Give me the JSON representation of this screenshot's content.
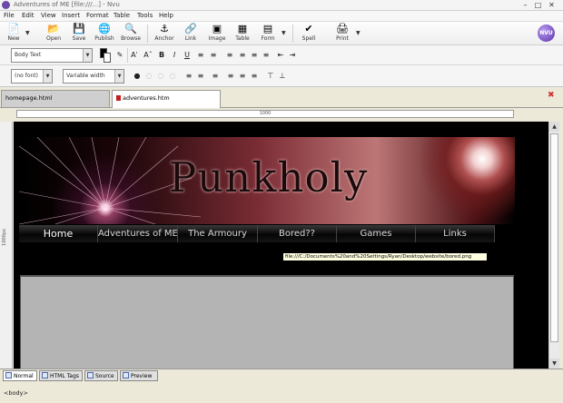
{
  "window": {
    "title": "Adventures of ME [file:///...] - Nvu"
  },
  "menu": [
    "File",
    "Edit",
    "View",
    "Insert",
    "Format",
    "Table",
    "Tools",
    "Help"
  ],
  "toolbar": {
    "new": "New",
    "open": "Open",
    "save": "Save",
    "publish": "Publish",
    "browse": "Browse",
    "anchor": "Anchor",
    "link": "Link",
    "image": "Image",
    "table": "Table",
    "form": "Form",
    "spell": "Spell",
    "print": "Print",
    "logo": "NVU"
  },
  "format": {
    "paragraph_format": "Body Text",
    "font": "(no font)",
    "width": "Variable width"
  },
  "tabs": {
    "inactive": "homepage.html",
    "active": "adventures.htm"
  },
  "ruler_label": "1000",
  "side_ruler_label": "1000px",
  "page": {
    "logo_text": "Punkholy",
    "nav": [
      "Home",
      "Adventures of ME",
      "The Armoury",
      "Bored??",
      "Games",
      "Links"
    ],
    "tooltip": "file:///C:/Documents%20and%20Settings/Ryan/Desktop/website/bored.png"
  },
  "modes": {
    "normal": "Normal",
    "html_tags": "HTML Tags",
    "source": "Source",
    "preview": "Preview"
  },
  "status": {
    "breadcrumb": "<body>"
  }
}
